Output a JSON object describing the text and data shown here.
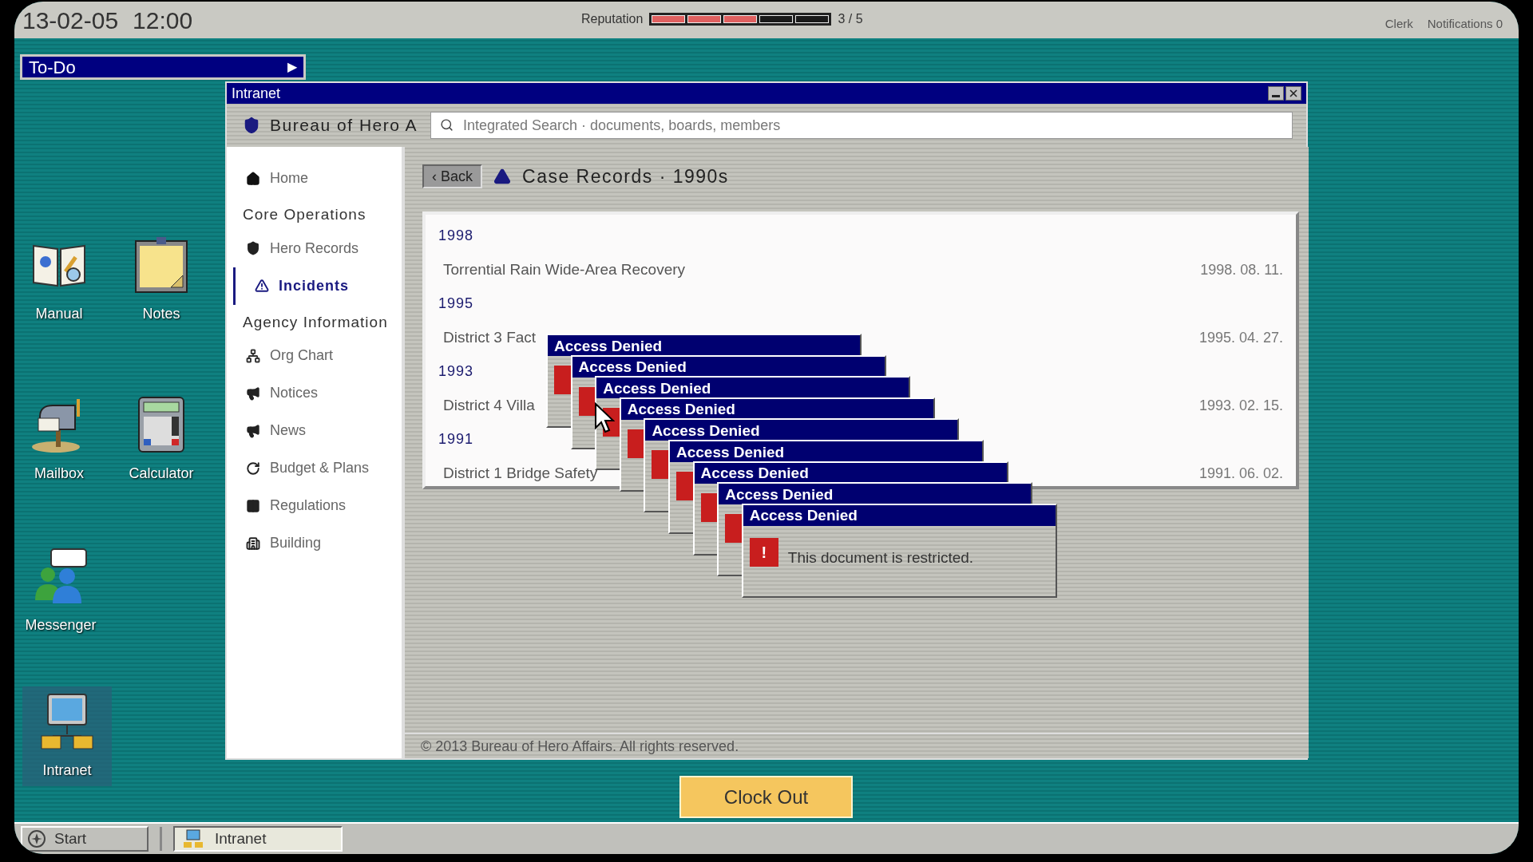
{
  "top_bar": {
    "date": "13-02-05",
    "time": "12:00",
    "reputation": {
      "label": "Reputation",
      "segments": [
        {
          "filled": true
        },
        {
          "filled": true
        },
        {
          "filled": true
        },
        {
          "filled": false
        },
        {
          "filled": false
        }
      ],
      "reading": "3 / 5"
    },
    "role": "Clerk",
    "notifications": "Notifications 0"
  },
  "todo": {
    "label": "To-Do",
    "arrow": "▶"
  },
  "desktop_icons": [
    {
      "label": "Manual",
      "kind": "manual",
      "selected": false
    },
    {
      "label": "Notes",
      "kind": "notes",
      "selected": false
    },
    {
      "label": "Mailbox",
      "kind": "mailbox",
      "selected": false
    },
    {
      "label": "Calculator",
      "kind": "calculator",
      "selected": false
    },
    {
      "label": "Messenger",
      "kind": "messenger",
      "selected": false
    },
    {
      "label": "Intranet",
      "kind": "intranet",
      "selected": true
    }
  ],
  "window": {
    "title": "Intranet",
    "site_name": "Bureau of Hero A",
    "search": {
      "placeholder": "Integrated Search · documents, boards, members"
    },
    "sidebar": [
      {
        "kind": "item",
        "label": "Home",
        "selected": false
      },
      {
        "kind": "section",
        "label": "Core Operations"
      },
      {
        "kind": "item",
        "label": "Hero Records",
        "selected": false
      },
      {
        "kind": "item",
        "label": "Incidents",
        "selected": true
      },
      {
        "kind": "section",
        "label": "Agency Information"
      },
      {
        "kind": "item",
        "label": "Org Chart",
        "selected": false
      },
      {
        "kind": "item",
        "label": "Notices",
        "selected": false
      },
      {
        "kind": "item",
        "label": "News",
        "selected": false
      },
      {
        "kind": "item",
        "label": "Budget & Plans",
        "selected": false
      },
      {
        "kind": "item",
        "label": "Regulations",
        "selected": false
      },
      {
        "kind": "item",
        "label": "Building",
        "selected": false
      }
    ],
    "back_button": "‹ Back",
    "page_title": "Case Records · 1990s",
    "records": [
      {
        "year": "1998",
        "title": "Torrential Rain Wide-Area Recovery",
        "date": "1998. 08. 11."
      },
      {
        "year": "1995",
        "title": "District 3 Fact",
        "date": "1995. 04. 27."
      },
      {
        "year": "1993",
        "title": "District 4 Villa",
        "date": "1993. 02. 15."
      },
      {
        "year": "1991",
        "title": "District 1 Bridge Safety",
        "date": "1991. 06. 02."
      }
    ],
    "footer": "© 2013 Bureau of Hero Affairs. All rights reserved."
  },
  "dialogs": [
    {
      "title": "Access Denied"
    },
    {
      "title": "Access Denied"
    },
    {
      "title": "Access Denied"
    },
    {
      "title": "Access Denied"
    },
    {
      "title": "Access Denied"
    },
    {
      "title": "Access Denied"
    },
    {
      "title": "Access Denied"
    },
    {
      "title": "Access Denied"
    },
    {
      "title": "Access Denied",
      "icon": "!",
      "message": "This document is restricted."
    }
  ],
  "clock_out": "Clock Out",
  "taskbar": {
    "start": "Start",
    "tasks": [
      {
        "label": "Intranet",
        "selected": true
      }
    ]
  }
}
